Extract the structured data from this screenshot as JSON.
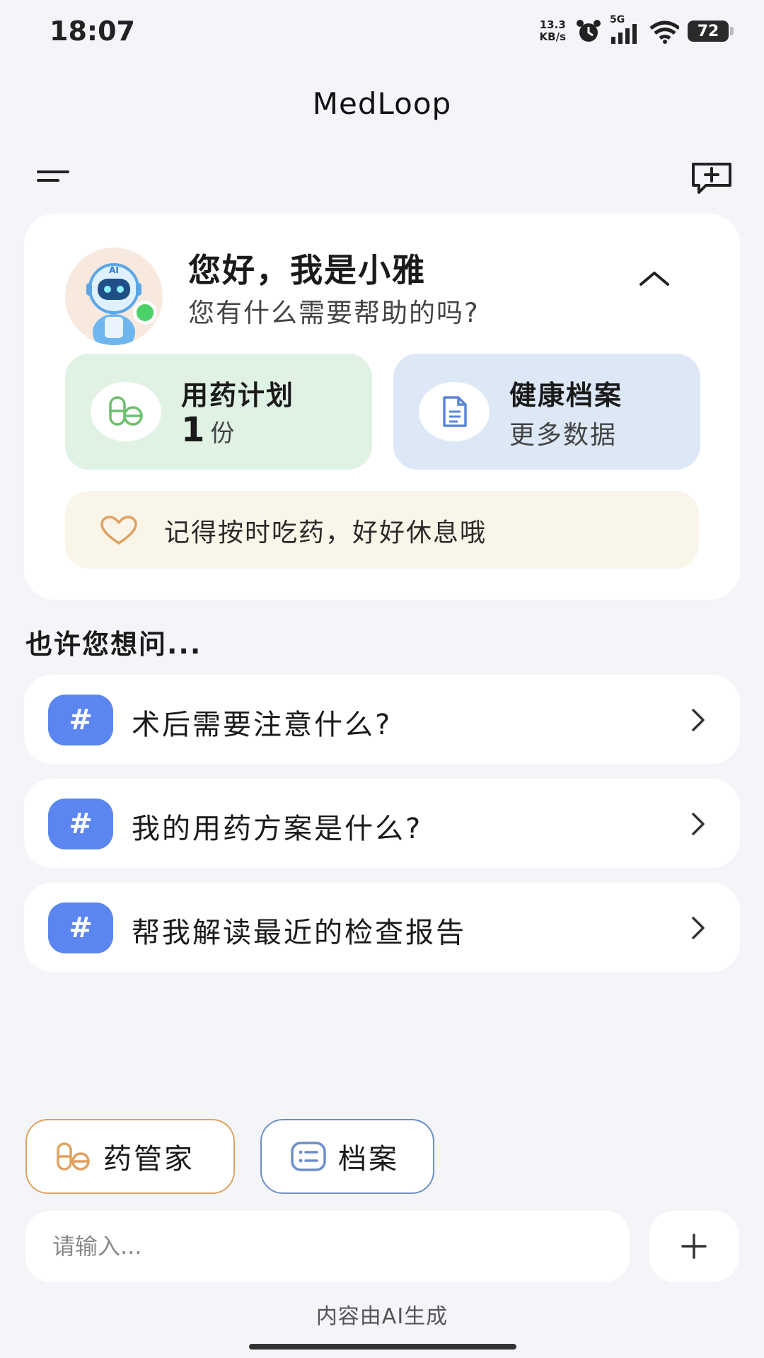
{
  "status_bar": {
    "time": "18:07",
    "net_speed_value": "13.3",
    "net_speed_unit": "KB/s",
    "network_type": "5G",
    "battery": "72",
    "icons": [
      "alarm-icon",
      "signal-icon",
      "wifi-icon",
      "battery-icon"
    ]
  },
  "header": {
    "title": "MedLoop"
  },
  "greeting": {
    "title": "您好，我是小雅",
    "subtitle": "您有什么需要帮助的吗?"
  },
  "tiles": {
    "medication_plan": {
      "title": "用药计划",
      "value": "1",
      "unit": "份"
    },
    "health_record": {
      "title": "健康档案",
      "subtitle": "更多数据"
    }
  },
  "reminder": {
    "text": "记得按时吃药，好好休息哦"
  },
  "suggestions": {
    "heading": "也许您想问...",
    "items": [
      {
        "hash": "#",
        "text": "术后需要注意什么?"
      },
      {
        "hash": "#",
        "text": "我的用药方案是什么?"
      },
      {
        "hash": "#",
        "text": "帮我解读最近的检查报告"
      }
    ]
  },
  "quick_actions": {
    "medication_manager": "药管家",
    "records": "档案"
  },
  "input": {
    "placeholder": "请输入..."
  },
  "footer": {
    "note": "内容由AI生成"
  },
  "colors": {
    "accent_blue": "#5b86ef",
    "medication_tile_bg": "#dff2e4",
    "record_tile_bg": "#dde8f7",
    "reminder_bg": "#f9f5e8",
    "online_green": "#4cd068",
    "med_chip_border": "#e0a161",
    "record_chip_border": "#6b8fc9"
  }
}
